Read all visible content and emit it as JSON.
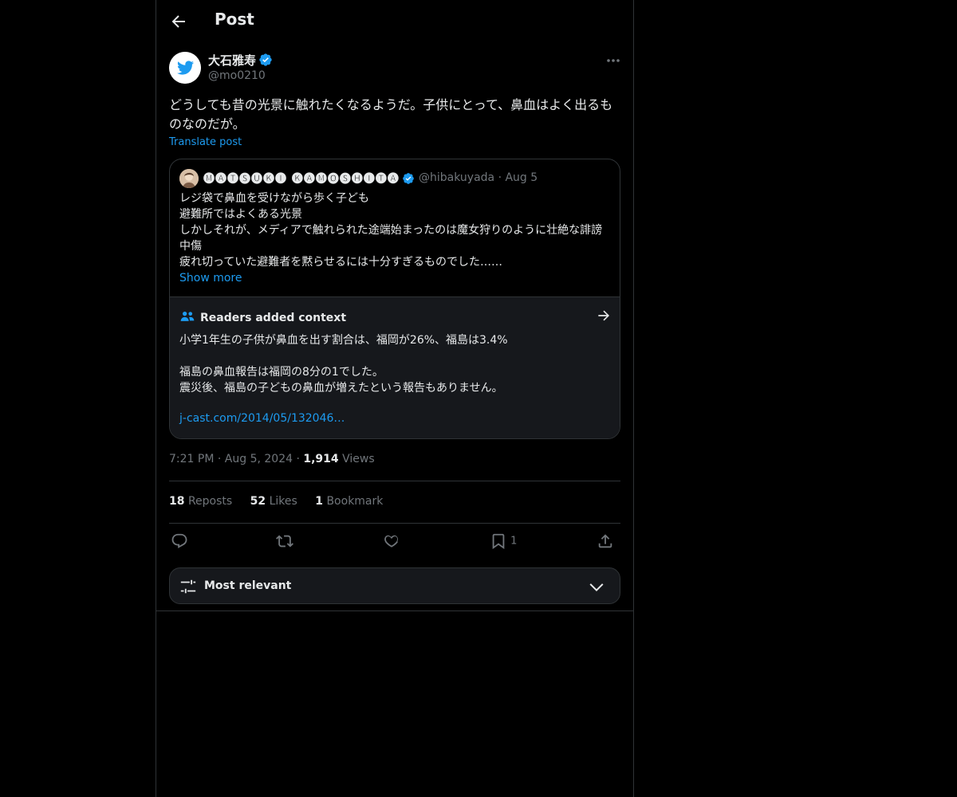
{
  "header": {
    "title": "Post"
  },
  "author": {
    "name": "大石雅寿",
    "handle": "@mo0210"
  },
  "post": {
    "text": "どうしても昔の光景に触れたくなるようだ。子供にとって、鼻血はよく出るものなのだが。",
    "translate_label": "Translate post"
  },
  "quote": {
    "name": "🅜🅐🅣🅢🅤🅚🅘 🅚🅐🅜🅞🅢🅗🅘🅣🅐",
    "handle": "@hibakuyada",
    "date": "Aug 5",
    "text": "レジ袋で鼻血を受けながら歩く子ども\n避難所ではよくある光景\nしかしそれが、メディアで触れられた途端始まったのは魔女狩りのように壮絶な誹謗中傷\n疲れ切っていた避難者を黙らせるには十分すぎるものでした……",
    "show_more": "Show more"
  },
  "community_note": {
    "title": "Readers added context",
    "text": "小学1年生の子供が鼻血を出す割合は、福岡が26%、福島は3.4%\n\n福島の鼻血報告は福岡の8分の1でした。\n震災後、福島の子どもの鼻血が増えたという報告もありません。",
    "link": "j-cast.com/2014/05/132046…"
  },
  "meta": {
    "time": "7:21 PM",
    "date": "Aug 5, 2024",
    "views_count": "1,914",
    "views_label": "Views"
  },
  "stats": {
    "reposts_count": "18",
    "reposts_label": "Reposts",
    "likes_count": "52",
    "likes_label": "Likes",
    "bookmarks_count": "1",
    "bookmarks_label": "Bookmark"
  },
  "actions": {
    "bookmark_count": "1"
  },
  "sort": {
    "label": "Most relevant"
  },
  "icons": {
    "back": "arrow-left-icon",
    "verified": "verified-badge-icon",
    "more": "more-dots-icon",
    "reply": "reply-icon",
    "repost": "repost-icon",
    "like": "heart-icon",
    "bookmark": "bookmark-icon",
    "share": "share-icon",
    "people": "people-icon",
    "arrow": "arrow-right-icon",
    "sliders": "sliders-icon",
    "chevron": "chevron-down-icon"
  },
  "colors": {
    "accent": "#1d9bf0",
    "background": "#000000",
    "text": "#e7e9ea",
    "muted": "#71767b"
  }
}
